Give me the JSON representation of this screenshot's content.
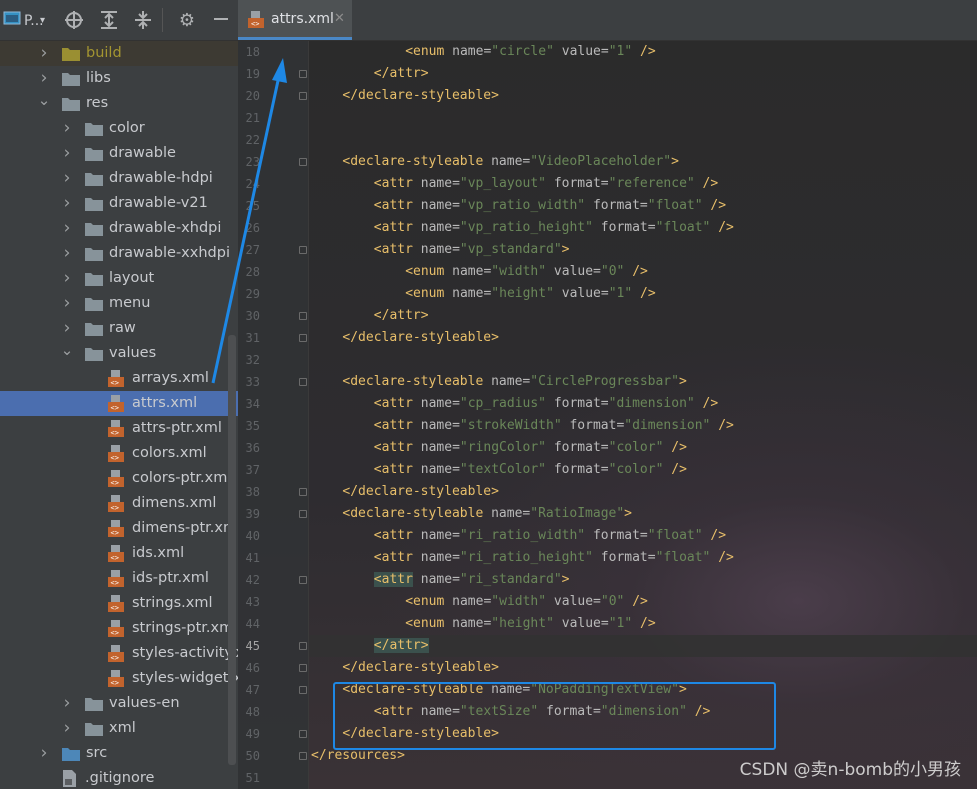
{
  "toolbar": {
    "project_label": "P...",
    "icons": [
      "project-icon",
      "locate-icon",
      "expand-all-icon",
      "collapse-all-icon",
      "gear-icon",
      "hide-icon"
    ]
  },
  "tree": [
    {
      "label": "build",
      "type": "folder",
      "depth": 1,
      "expanded": false,
      "color": "#9a8f32"
    },
    {
      "label": "libs",
      "type": "folder",
      "depth": 1,
      "expanded": false
    },
    {
      "label": "res",
      "type": "folder",
      "depth": 1,
      "expanded": true
    },
    {
      "label": "color",
      "type": "folder",
      "depth": 2,
      "expanded": false
    },
    {
      "label": "drawable",
      "type": "folder",
      "depth": 2,
      "expanded": false
    },
    {
      "label": "drawable-hdpi",
      "type": "folder",
      "depth": 2,
      "expanded": false
    },
    {
      "label": "drawable-v21",
      "type": "folder",
      "depth": 2,
      "expanded": false
    },
    {
      "label": "drawable-xhdpi",
      "type": "folder",
      "depth": 2,
      "expanded": false
    },
    {
      "label": "drawable-xxhdpi",
      "type": "folder",
      "depth": 2,
      "expanded": false
    },
    {
      "label": "layout",
      "type": "folder",
      "depth": 2,
      "expanded": false
    },
    {
      "label": "menu",
      "type": "folder",
      "depth": 2,
      "expanded": false
    },
    {
      "label": "raw",
      "type": "folder",
      "depth": 2,
      "expanded": false
    },
    {
      "label": "values",
      "type": "folder",
      "depth": 2,
      "expanded": true
    },
    {
      "label": "arrays.xml",
      "type": "xml",
      "depth": 3
    },
    {
      "label": "attrs.xml",
      "type": "xml",
      "depth": 3,
      "selected": true
    },
    {
      "label": "attrs-ptr.xml",
      "type": "xml",
      "depth": 3
    },
    {
      "label": "colors.xml",
      "type": "xml",
      "depth": 3
    },
    {
      "label": "colors-ptr.xml",
      "type": "xml",
      "depth": 3
    },
    {
      "label": "dimens.xml",
      "type": "xml",
      "depth": 3
    },
    {
      "label": "dimens-ptr.xml",
      "type": "xml",
      "depth": 3
    },
    {
      "label": "ids.xml",
      "type": "xml",
      "depth": 3
    },
    {
      "label": "ids-ptr.xml",
      "type": "xml",
      "depth": 3
    },
    {
      "label": "strings.xml",
      "type": "xml",
      "depth": 3
    },
    {
      "label": "strings-ptr.xml",
      "type": "xml",
      "depth": 3
    },
    {
      "label": "styles-activity.xn",
      "type": "xml",
      "depth": 3
    },
    {
      "label": "styles-widget.xn",
      "type": "xml",
      "depth": 3
    },
    {
      "label": "values-en",
      "type": "folder",
      "depth": 2,
      "expanded": false
    },
    {
      "label": "xml",
      "type": "folder",
      "depth": 2,
      "expanded": false
    },
    {
      "label": "src",
      "type": "folder",
      "depth": 1,
      "expanded": false,
      "color": "#4d87b8"
    },
    {
      "label": ".gitignore",
      "type": "file",
      "depth": 1
    }
  ],
  "tab": {
    "label": "attrs.xml",
    "close": "✕"
  },
  "editor": {
    "current_line": 45,
    "lines": [
      {
        "n": 18,
        "indent": 12,
        "tokens": [
          [
            "t",
            "<enum "
          ],
          [
            "a",
            "name="
          ],
          [
            "v",
            "\"circle\" "
          ],
          [
            "a",
            "value="
          ],
          [
            "v",
            "\"1\" "
          ],
          [
            "t",
            "/>"
          ]
        ]
      },
      {
        "n": 19,
        "indent": 8,
        "tokens": [
          [
            "t",
            "</attr>"
          ]
        ]
      },
      {
        "n": 20,
        "indent": 4,
        "tokens": [
          [
            "t",
            "</declare-styleable>"
          ]
        ]
      },
      {
        "n": 21,
        "indent": 0,
        "tokens": []
      },
      {
        "n": 22,
        "indent": 0,
        "tokens": []
      },
      {
        "n": 23,
        "indent": 4,
        "tokens": [
          [
            "t",
            "<declare-styleable "
          ],
          [
            "a",
            "name="
          ],
          [
            "v",
            "\"VideoPlaceholder\""
          ],
          [
            "t",
            ">"
          ]
        ]
      },
      {
        "n": 24,
        "indent": 8,
        "tokens": [
          [
            "t",
            "<attr "
          ],
          [
            "a",
            "name="
          ],
          [
            "v",
            "\"vp_layout\" "
          ],
          [
            "a",
            "format="
          ],
          [
            "v",
            "\"reference\" "
          ],
          [
            "t",
            "/>"
          ]
        ]
      },
      {
        "n": 25,
        "indent": 8,
        "tokens": [
          [
            "t",
            "<attr "
          ],
          [
            "a",
            "name="
          ],
          [
            "v",
            "\"vp_ratio_width\" "
          ],
          [
            "a",
            "format="
          ],
          [
            "v",
            "\"float\" "
          ],
          [
            "t",
            "/>"
          ]
        ]
      },
      {
        "n": 26,
        "indent": 8,
        "tokens": [
          [
            "t",
            "<attr "
          ],
          [
            "a",
            "name="
          ],
          [
            "v",
            "\"vp_ratio_height\" "
          ],
          [
            "a",
            "format="
          ],
          [
            "v",
            "\"float\" "
          ],
          [
            "t",
            "/>"
          ]
        ]
      },
      {
        "n": 27,
        "indent": 8,
        "tokens": [
          [
            "t",
            "<attr "
          ],
          [
            "a",
            "name="
          ],
          [
            "v",
            "\"vp_standard\""
          ],
          [
            "t",
            ">"
          ]
        ]
      },
      {
        "n": 28,
        "indent": 12,
        "tokens": [
          [
            "t",
            "<enum "
          ],
          [
            "a",
            "name="
          ],
          [
            "v",
            "\"width\" "
          ],
          [
            "a",
            "value="
          ],
          [
            "v",
            "\"0\" "
          ],
          [
            "t",
            "/>"
          ]
        ]
      },
      {
        "n": 29,
        "indent": 12,
        "tokens": [
          [
            "t",
            "<enum "
          ],
          [
            "a",
            "name="
          ],
          [
            "v",
            "\"height\" "
          ],
          [
            "a",
            "value="
          ],
          [
            "v",
            "\"1\" "
          ],
          [
            "t",
            "/>"
          ]
        ]
      },
      {
        "n": 30,
        "indent": 8,
        "tokens": [
          [
            "t",
            "</attr>"
          ]
        ]
      },
      {
        "n": 31,
        "indent": 4,
        "tokens": [
          [
            "t",
            "</declare-styleable>"
          ]
        ]
      },
      {
        "n": 32,
        "indent": 0,
        "tokens": []
      },
      {
        "n": 33,
        "indent": 4,
        "tokens": [
          [
            "t",
            "<declare-styleable "
          ],
          [
            "a",
            "name="
          ],
          [
            "v",
            "\"CircleProgressbar\""
          ],
          [
            "t",
            ">"
          ]
        ]
      },
      {
        "n": 34,
        "indent": 8,
        "tokens": [
          [
            "t",
            "<attr "
          ],
          [
            "a",
            "name="
          ],
          [
            "v",
            "\"cp_radius\" "
          ],
          [
            "a",
            "format="
          ],
          [
            "v",
            "\"dimension\" "
          ],
          [
            "t",
            "/>"
          ]
        ]
      },
      {
        "n": 35,
        "indent": 8,
        "tokens": [
          [
            "t",
            "<attr "
          ],
          [
            "a",
            "name="
          ],
          [
            "v",
            "\"strokeWidth\" "
          ],
          [
            "a",
            "format="
          ],
          [
            "v",
            "\"dimension\" "
          ],
          [
            "t",
            "/>"
          ]
        ]
      },
      {
        "n": 36,
        "indent": 8,
        "tokens": [
          [
            "t",
            "<attr "
          ],
          [
            "a",
            "name="
          ],
          [
            "v",
            "\"ringColor\" "
          ],
          [
            "a",
            "format="
          ],
          [
            "v",
            "\"color\" "
          ],
          [
            "t",
            "/>"
          ]
        ]
      },
      {
        "n": 37,
        "indent": 8,
        "tokens": [
          [
            "t",
            "<attr "
          ],
          [
            "a",
            "name="
          ],
          [
            "v",
            "\"textColor\" "
          ],
          [
            "a",
            "format="
          ],
          [
            "v",
            "\"color\" "
          ],
          [
            "t",
            "/>"
          ]
        ]
      },
      {
        "n": 38,
        "indent": 4,
        "tokens": [
          [
            "t",
            "</declare-styleable>"
          ]
        ]
      },
      {
        "n": 39,
        "indent": 4,
        "tokens": [
          [
            "t",
            "<declare-styleable "
          ],
          [
            "a",
            "name="
          ],
          [
            "v",
            "\"RatioImage\""
          ],
          [
            "t",
            ">"
          ]
        ]
      },
      {
        "n": 40,
        "indent": 8,
        "tokens": [
          [
            "t",
            "<attr "
          ],
          [
            "a",
            "name="
          ],
          [
            "v",
            "\"ri_ratio_width\" "
          ],
          [
            "a",
            "format="
          ],
          [
            "v",
            "\"float\" "
          ],
          [
            "t",
            "/>"
          ]
        ]
      },
      {
        "n": 41,
        "indent": 8,
        "tokens": [
          [
            "t",
            "<attr "
          ],
          [
            "a",
            "name="
          ],
          [
            "v",
            "\"ri_ratio_height\" "
          ],
          [
            "a",
            "format="
          ],
          [
            "v",
            "\"float\" "
          ],
          [
            "t",
            "/>"
          ]
        ]
      },
      {
        "n": 42,
        "indent": 8,
        "tokens": [
          [
            "th",
            "<attr"
          ],
          [
            "p",
            " "
          ],
          [
            "a",
            "name="
          ],
          [
            "v",
            "\"ri_standard\""
          ],
          [
            "t",
            ">"
          ]
        ]
      },
      {
        "n": 43,
        "indent": 12,
        "tokens": [
          [
            "t",
            "<enum "
          ],
          [
            "a",
            "name="
          ],
          [
            "v",
            "\"width\" "
          ],
          [
            "a",
            "value="
          ],
          [
            "v",
            "\"0\" "
          ],
          [
            "t",
            "/>"
          ]
        ]
      },
      {
        "n": 44,
        "indent": 12,
        "tokens": [
          [
            "t",
            "<enum "
          ],
          [
            "a",
            "name="
          ],
          [
            "v",
            "\"height\" "
          ],
          [
            "a",
            "value="
          ],
          [
            "v",
            "\"1\" "
          ],
          [
            "t",
            "/>"
          ]
        ]
      },
      {
        "n": 45,
        "indent": 8,
        "tokens": [
          [
            "th",
            "</attr>"
          ]
        ]
      },
      {
        "n": 46,
        "indent": 4,
        "tokens": [
          [
            "t",
            "</declare-styleable>"
          ]
        ]
      },
      {
        "n": 47,
        "indent": 4,
        "tokens": [
          [
            "t",
            "<declare-styleable "
          ],
          [
            "a",
            "name="
          ],
          [
            "v",
            "\"NoPaddingTextView\""
          ],
          [
            "t",
            ">"
          ]
        ]
      },
      {
        "n": 48,
        "indent": 8,
        "tokens": [
          [
            "t",
            "<attr "
          ],
          [
            "a",
            "name="
          ],
          [
            "v",
            "\"textSize\" "
          ],
          [
            "a",
            "format="
          ],
          [
            "v",
            "\"dimension\" "
          ],
          [
            "t",
            "/>"
          ]
        ]
      },
      {
        "n": 49,
        "indent": 4,
        "tokens": [
          [
            "t",
            "</declare-styleable>"
          ]
        ]
      },
      {
        "n": 50,
        "indent": 0,
        "tokens": [
          [
            "t",
            "</resources>"
          ]
        ]
      },
      {
        "n": 51,
        "indent": 0,
        "tokens": []
      }
    ],
    "fold_lines": [
      19,
      20,
      23,
      27,
      30,
      31,
      33,
      38,
      39,
      42,
      45,
      46,
      47,
      49,
      50
    ]
  },
  "watermark": "CSDN @卖n-bomb的小男孩",
  "colors": {
    "accent": "#4b6eaf",
    "annotation": "#1e88e5",
    "tag": "#e8bf6a",
    "value": "#6a8759"
  }
}
